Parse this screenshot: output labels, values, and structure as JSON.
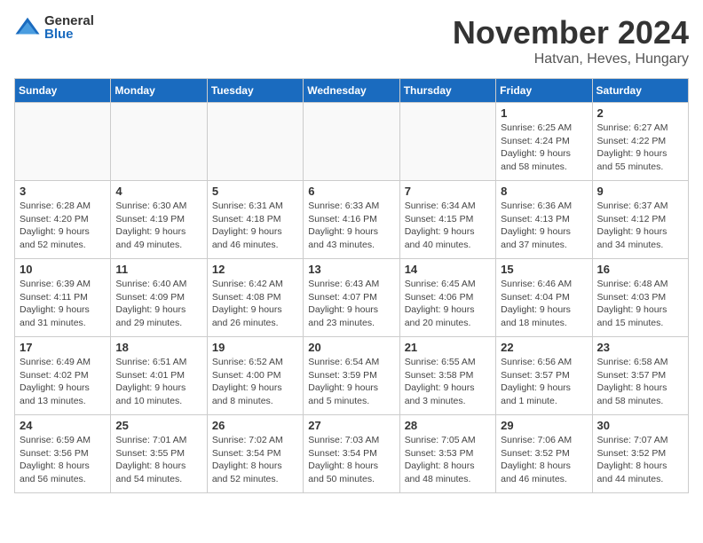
{
  "logo": {
    "general": "General",
    "blue": "Blue"
  },
  "title": "November 2024",
  "location": "Hatvan, Heves, Hungary",
  "days_of_week": [
    "Sunday",
    "Monday",
    "Tuesday",
    "Wednesday",
    "Thursday",
    "Friday",
    "Saturday"
  ],
  "weeks": [
    [
      {
        "day": "",
        "info": ""
      },
      {
        "day": "",
        "info": ""
      },
      {
        "day": "",
        "info": ""
      },
      {
        "day": "",
        "info": ""
      },
      {
        "day": "",
        "info": ""
      },
      {
        "day": "1",
        "info": "Sunrise: 6:25 AM\nSunset: 4:24 PM\nDaylight: 9 hours and 58 minutes."
      },
      {
        "day": "2",
        "info": "Sunrise: 6:27 AM\nSunset: 4:22 PM\nDaylight: 9 hours and 55 minutes."
      }
    ],
    [
      {
        "day": "3",
        "info": "Sunrise: 6:28 AM\nSunset: 4:20 PM\nDaylight: 9 hours and 52 minutes."
      },
      {
        "day": "4",
        "info": "Sunrise: 6:30 AM\nSunset: 4:19 PM\nDaylight: 9 hours and 49 minutes."
      },
      {
        "day": "5",
        "info": "Sunrise: 6:31 AM\nSunset: 4:18 PM\nDaylight: 9 hours and 46 minutes."
      },
      {
        "day": "6",
        "info": "Sunrise: 6:33 AM\nSunset: 4:16 PM\nDaylight: 9 hours and 43 minutes."
      },
      {
        "day": "7",
        "info": "Sunrise: 6:34 AM\nSunset: 4:15 PM\nDaylight: 9 hours and 40 minutes."
      },
      {
        "day": "8",
        "info": "Sunrise: 6:36 AM\nSunset: 4:13 PM\nDaylight: 9 hours and 37 minutes."
      },
      {
        "day": "9",
        "info": "Sunrise: 6:37 AM\nSunset: 4:12 PM\nDaylight: 9 hours and 34 minutes."
      }
    ],
    [
      {
        "day": "10",
        "info": "Sunrise: 6:39 AM\nSunset: 4:11 PM\nDaylight: 9 hours and 31 minutes."
      },
      {
        "day": "11",
        "info": "Sunrise: 6:40 AM\nSunset: 4:09 PM\nDaylight: 9 hours and 29 minutes."
      },
      {
        "day": "12",
        "info": "Sunrise: 6:42 AM\nSunset: 4:08 PM\nDaylight: 9 hours and 26 minutes."
      },
      {
        "day": "13",
        "info": "Sunrise: 6:43 AM\nSunset: 4:07 PM\nDaylight: 9 hours and 23 minutes."
      },
      {
        "day": "14",
        "info": "Sunrise: 6:45 AM\nSunset: 4:06 PM\nDaylight: 9 hours and 20 minutes."
      },
      {
        "day": "15",
        "info": "Sunrise: 6:46 AM\nSunset: 4:04 PM\nDaylight: 9 hours and 18 minutes."
      },
      {
        "day": "16",
        "info": "Sunrise: 6:48 AM\nSunset: 4:03 PM\nDaylight: 9 hours and 15 minutes."
      }
    ],
    [
      {
        "day": "17",
        "info": "Sunrise: 6:49 AM\nSunset: 4:02 PM\nDaylight: 9 hours and 13 minutes."
      },
      {
        "day": "18",
        "info": "Sunrise: 6:51 AM\nSunset: 4:01 PM\nDaylight: 9 hours and 10 minutes."
      },
      {
        "day": "19",
        "info": "Sunrise: 6:52 AM\nSunset: 4:00 PM\nDaylight: 9 hours and 8 minutes."
      },
      {
        "day": "20",
        "info": "Sunrise: 6:54 AM\nSunset: 3:59 PM\nDaylight: 9 hours and 5 minutes."
      },
      {
        "day": "21",
        "info": "Sunrise: 6:55 AM\nSunset: 3:58 PM\nDaylight: 9 hours and 3 minutes."
      },
      {
        "day": "22",
        "info": "Sunrise: 6:56 AM\nSunset: 3:57 PM\nDaylight: 9 hours and 1 minute."
      },
      {
        "day": "23",
        "info": "Sunrise: 6:58 AM\nSunset: 3:57 PM\nDaylight: 8 hours and 58 minutes."
      }
    ],
    [
      {
        "day": "24",
        "info": "Sunrise: 6:59 AM\nSunset: 3:56 PM\nDaylight: 8 hours and 56 minutes."
      },
      {
        "day": "25",
        "info": "Sunrise: 7:01 AM\nSunset: 3:55 PM\nDaylight: 8 hours and 54 minutes."
      },
      {
        "day": "26",
        "info": "Sunrise: 7:02 AM\nSunset: 3:54 PM\nDaylight: 8 hours and 52 minutes."
      },
      {
        "day": "27",
        "info": "Sunrise: 7:03 AM\nSunset: 3:54 PM\nDaylight: 8 hours and 50 minutes."
      },
      {
        "day": "28",
        "info": "Sunrise: 7:05 AM\nSunset: 3:53 PM\nDaylight: 8 hours and 48 minutes."
      },
      {
        "day": "29",
        "info": "Sunrise: 7:06 AM\nSunset: 3:52 PM\nDaylight: 8 hours and 46 minutes."
      },
      {
        "day": "30",
        "info": "Sunrise: 7:07 AM\nSunset: 3:52 PM\nDaylight: 8 hours and 44 minutes."
      }
    ]
  ]
}
